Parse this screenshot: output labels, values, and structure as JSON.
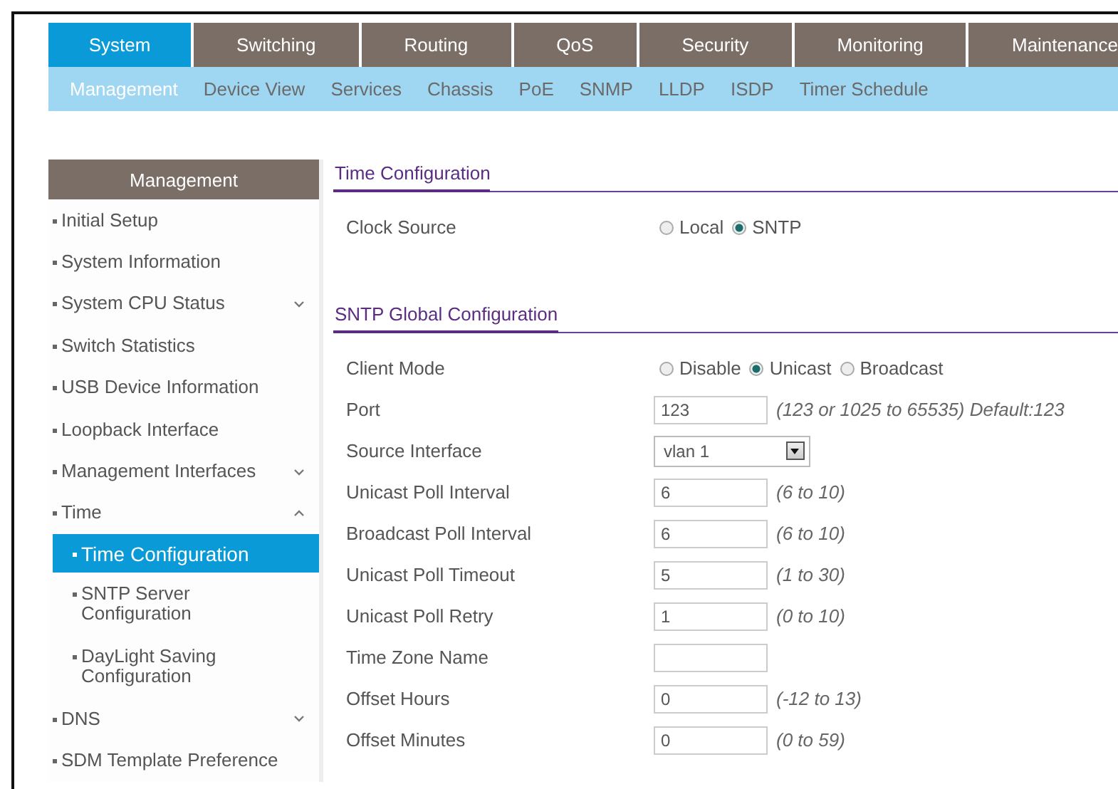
{
  "tabs": [
    {
      "label": "System",
      "selected": true
    },
    {
      "label": "Switching",
      "selected": false
    },
    {
      "label": "Routing",
      "selected": false
    },
    {
      "label": "QoS",
      "selected": false
    },
    {
      "label": "Security",
      "selected": false
    },
    {
      "label": "Monitoring",
      "selected": false
    },
    {
      "label": "Maintenance",
      "selected": false
    }
  ],
  "subtabs": [
    {
      "label": "Management",
      "selected": true
    },
    {
      "label": "Device View",
      "selected": false
    },
    {
      "label": "Services",
      "selected": false
    },
    {
      "label": "Chassis",
      "selected": false
    },
    {
      "label": "PoE",
      "selected": false
    },
    {
      "label": "SNMP",
      "selected": false
    },
    {
      "label": "LLDP",
      "selected": false
    },
    {
      "label": "ISDP",
      "selected": false
    },
    {
      "label": "Timer Schedule",
      "selected": false
    }
  ],
  "sidebar": {
    "title": "Management",
    "items": [
      {
        "label": "Initial Setup",
        "selected": false
      },
      {
        "label": "System Information",
        "selected": false
      },
      {
        "label": "System CPU Status",
        "selected": false,
        "expanded": false
      },
      {
        "label": "Switch Statistics",
        "selected": false
      },
      {
        "label": "USB Device Information",
        "selected": false
      },
      {
        "label": "Loopback Interface",
        "selected": false
      },
      {
        "label": "Management Interfaces",
        "selected": false,
        "expanded": false
      },
      {
        "label": "Time",
        "selected": false,
        "expanded": true,
        "children": [
          {
            "label": "Time Configuration",
            "selected": true
          },
          {
            "label": "SNTP Server Configuration",
            "selected": false
          },
          {
            "label": "DayLight Saving Configuration",
            "selected": false
          }
        ]
      },
      {
        "label": "DNS",
        "selected": false,
        "expanded": false
      },
      {
        "label": "SDM Template Preference",
        "selected": false
      }
    ]
  },
  "sections": [
    {
      "title": "Time Configuration",
      "rows": [
        {
          "kind": "radio",
          "label": "Clock Source",
          "options": [
            {
              "label": "Local",
              "selected": false
            },
            {
              "label": "SNTP",
              "selected": true
            }
          ]
        }
      ]
    },
    {
      "title": "SNTP Global Configuration",
      "rows": [
        {
          "kind": "radio",
          "label": "Client Mode",
          "options": [
            {
              "label": "Disable",
              "selected": false
            },
            {
              "label": "Unicast",
              "selected": true
            },
            {
              "label": "Broadcast",
              "selected": false
            }
          ]
        },
        {
          "kind": "text",
          "label": "Port",
          "value": "123",
          "hint": "(123 or 1025 to 65535) Default:123"
        },
        {
          "kind": "select",
          "label": "Source Interface",
          "value": "vlan 1"
        },
        {
          "kind": "text",
          "label": "Unicast Poll Interval",
          "value": "6",
          "hint": "(6 to 10)"
        },
        {
          "kind": "text",
          "label": "Broadcast Poll Interval",
          "value": "6",
          "hint": "(6 to 10)"
        },
        {
          "kind": "text",
          "label": "Unicast Poll Timeout",
          "value": "5",
          "hint": "(1 to 30)"
        },
        {
          "kind": "text",
          "label": "Unicast Poll Retry",
          "value": "1",
          "hint": "(0 to 10)"
        },
        {
          "kind": "text",
          "label": "Time Zone Name",
          "value": ""
        },
        {
          "kind": "text",
          "label": "Offset Hours",
          "value": "0",
          "hint": "(-12 to 13)"
        },
        {
          "kind": "text",
          "label": "Offset Minutes",
          "value": "0",
          "hint": "(0 to 59)"
        }
      ]
    }
  ]
}
